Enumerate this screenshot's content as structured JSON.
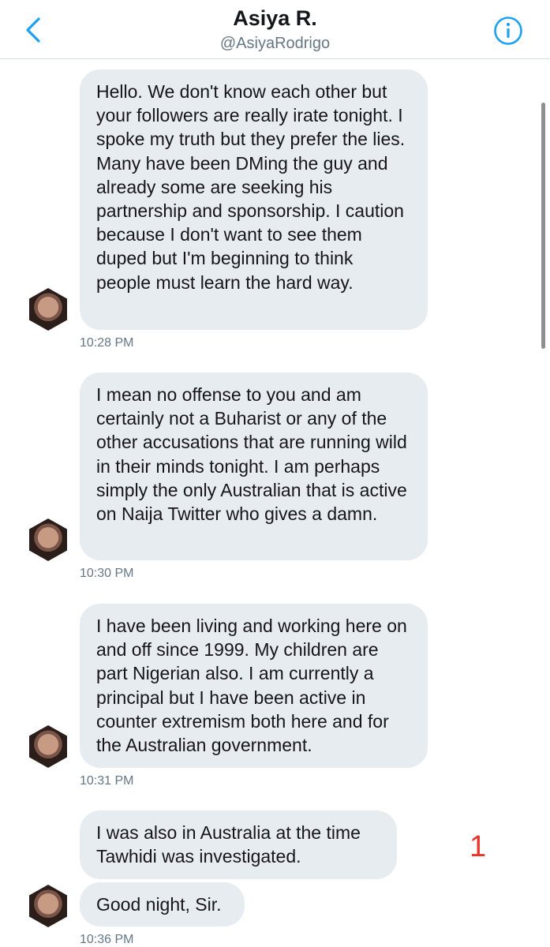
{
  "header": {
    "title": "Asiya R.",
    "handle": "@AsiyaRodrigo",
    "back_icon": "chevron-left-icon",
    "info_icon": "info-icon",
    "accent_color": "#1da1f2"
  },
  "messages": [
    {
      "text": "Hello. We don't know each other but your followers are really irate tonight. I spoke my truth but they prefer the lies. Many have been DMing the guy and already some are seeking his partnership and sponsorship. I caution because I don't want to see them duped but I'm beginning to think people must learn the hard way.",
      "time": "10:28 PM"
    },
    {
      "text": "I mean no offense to you and am certainly not a Buharist or any of the other accusations that are running wild in their minds tonight. I am perhaps simply the only Australian that is active on Naija Twitter who gives a damn.",
      "time": "10:30 PM"
    },
    {
      "text": "I have been living and working here on and off since 1999. My children are part Nigerian also. I am currently a principal but I have been active in counter extremism both here and for the Australian government.",
      "time": "10:31 PM"
    },
    {
      "text": "I was also in Australia at the time Tawhidi was investigated.",
      "time": ""
    },
    {
      "text": "Good night, Sir.",
      "time": "10:36 PM"
    }
  ],
  "annotation": {
    "text": "1",
    "color": "#e8352c"
  }
}
